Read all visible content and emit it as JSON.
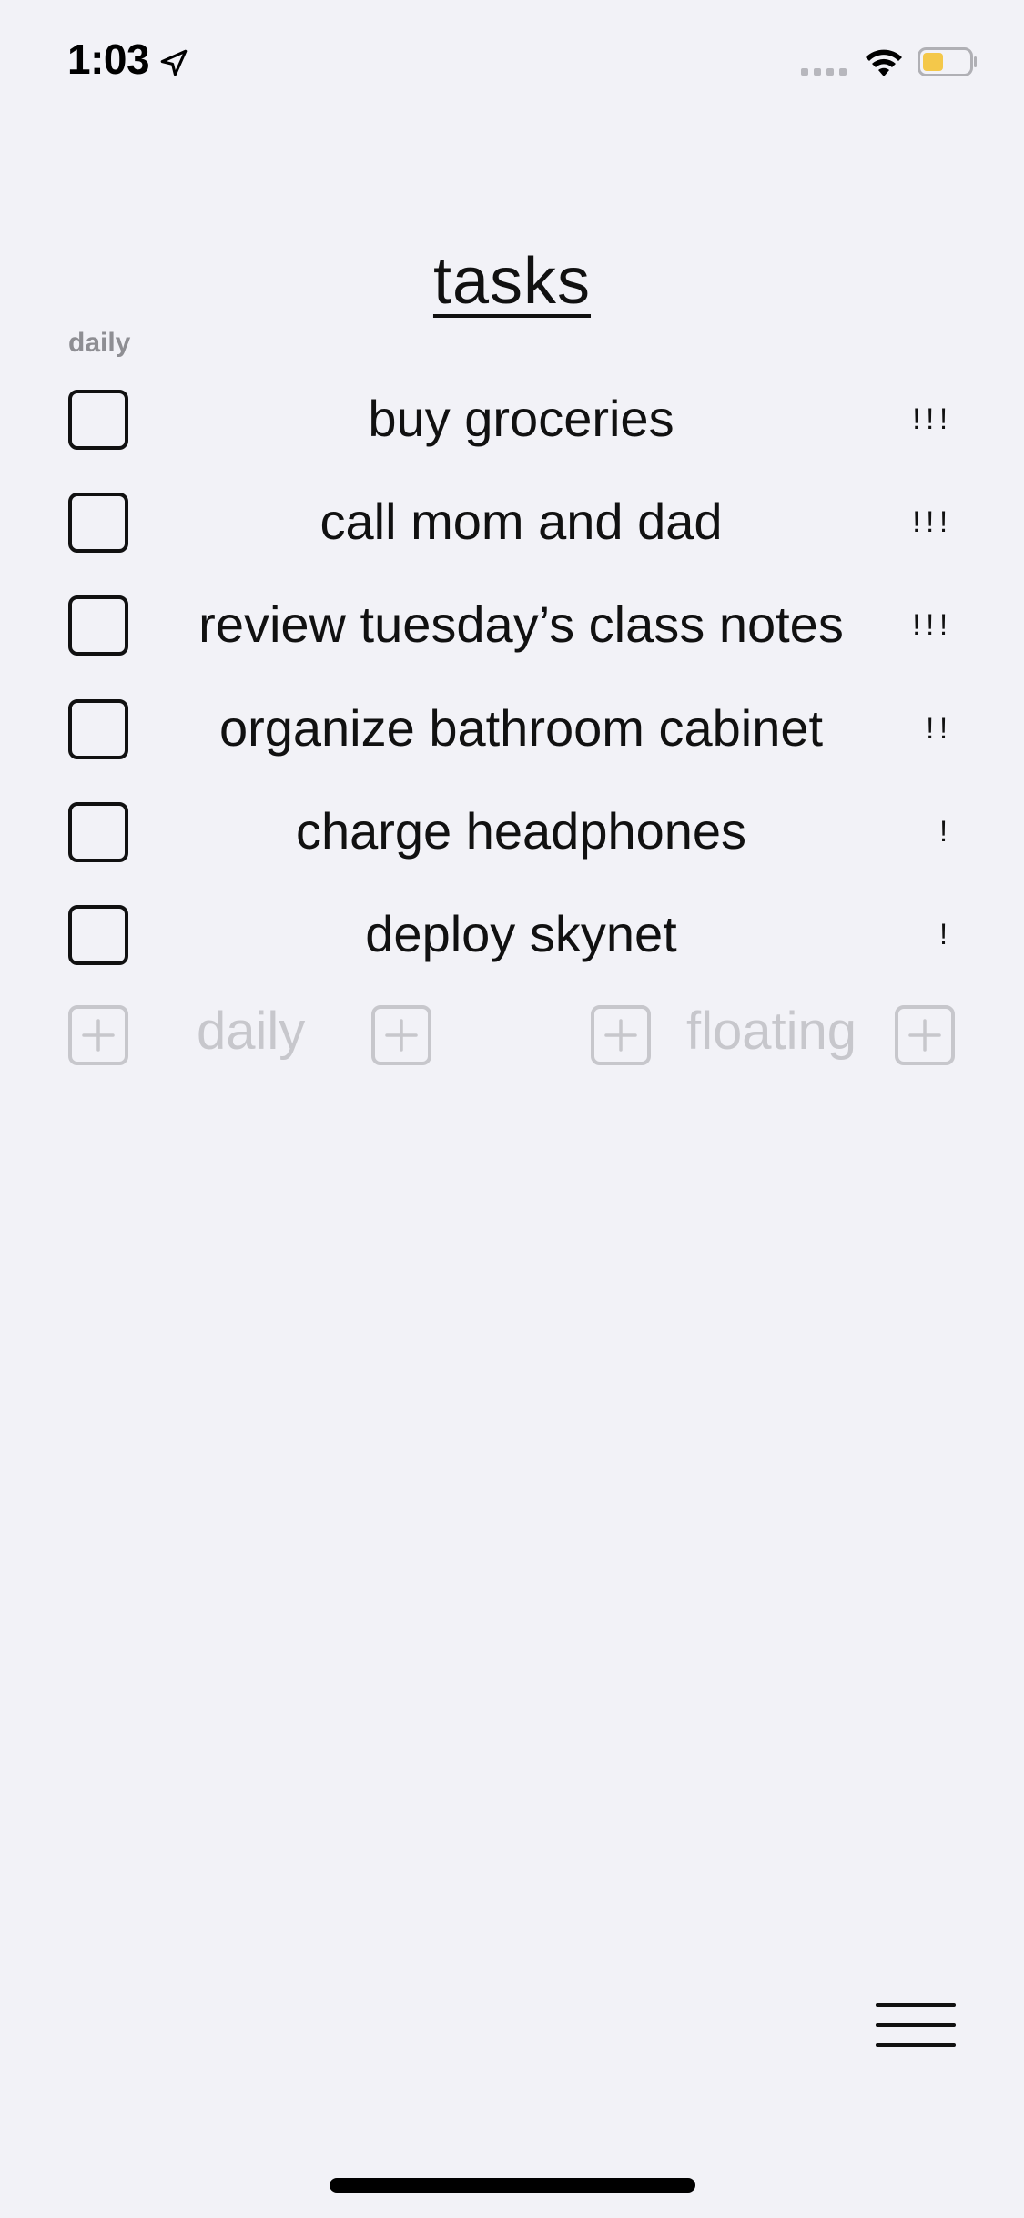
{
  "status_bar": {
    "time": "1:03",
    "icons": [
      "location-arrow-icon",
      "signal-dots-icon",
      "wifi-icon",
      "battery-icon"
    ],
    "battery_color": "#f4c84a"
  },
  "title": "tasks",
  "section": {
    "label": "daily"
  },
  "tasks": [
    {
      "text": "buy groceries",
      "priority": "!!!"
    },
    {
      "text": "call mom and dad",
      "priority": "!!!"
    },
    {
      "text": "review tuesday’s class notes",
      "priority": "!!!"
    },
    {
      "text": "organize bathroom cabinet",
      "priority": "!!"
    },
    {
      "text": "charge headphones",
      "priority": "!"
    },
    {
      "text": "deploy skynet",
      "priority": "!"
    }
  ],
  "add_controls": {
    "daily_label": "daily",
    "floating_label": "floating"
  },
  "colors": {
    "background": "#f2f2f7",
    "text": "#111111",
    "muted": "#8e8e93",
    "disabled": "#c7c7cc"
  },
  "icons": {
    "menu": "hamburger-menu-icon",
    "add": "plus-square-icon"
  }
}
